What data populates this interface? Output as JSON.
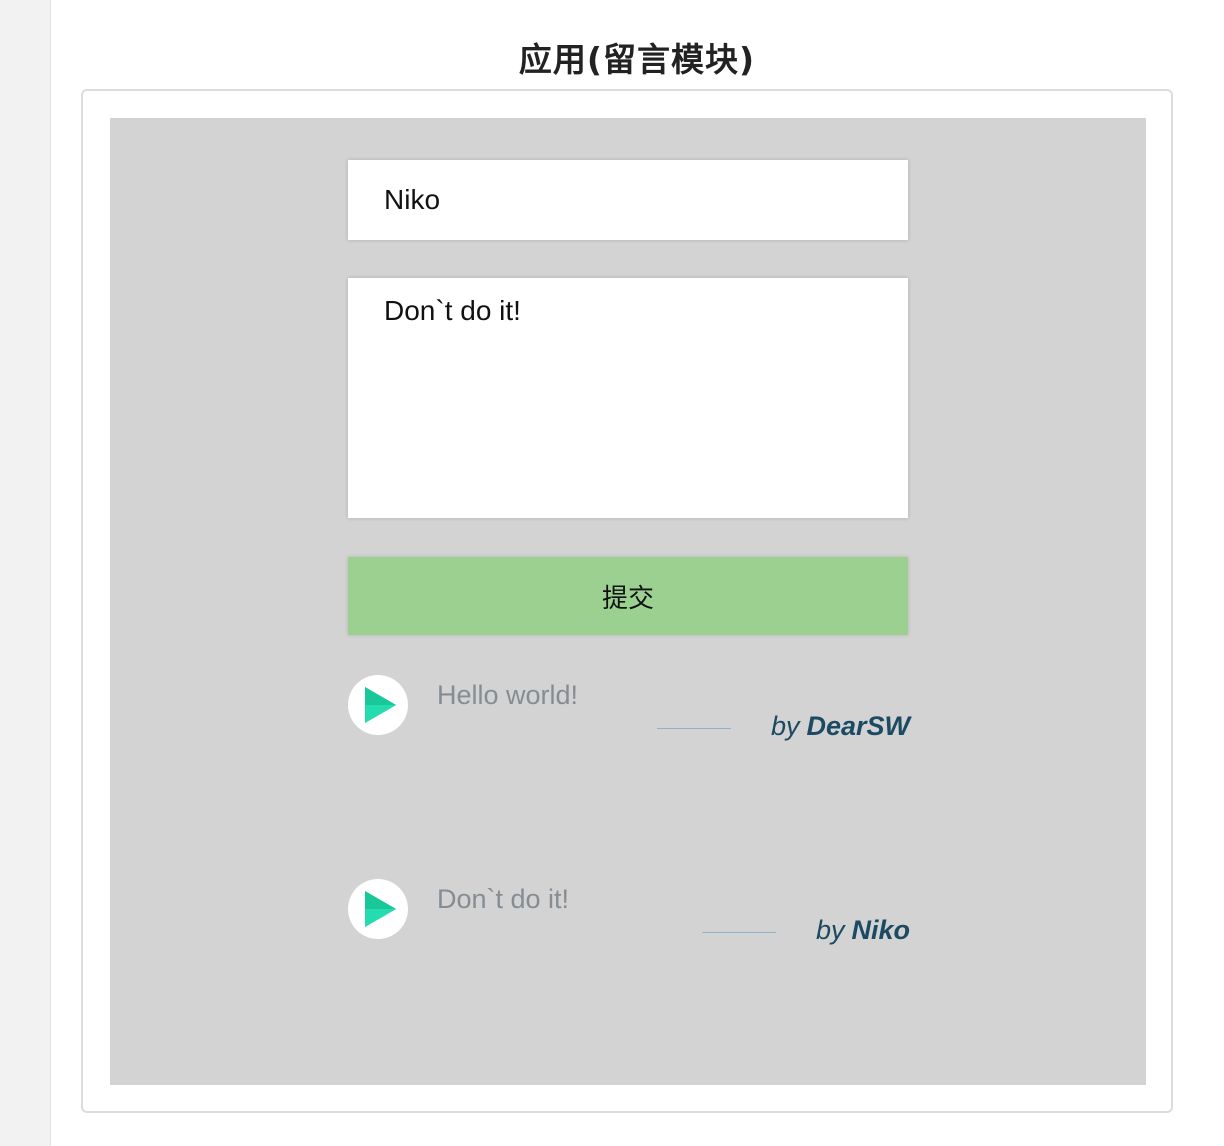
{
  "page": {
    "title": "应用(留言模块)"
  },
  "form": {
    "name_value": "Niko",
    "content_value": "Don`t do it!",
    "submit_label": "提交"
  },
  "comments": [
    {
      "text": "Hello world!",
      "by_label": "by",
      "author": "DearSW",
      "avatar_icon": "play-icon"
    },
    {
      "text": "Don`t do it!",
      "by_label": "by",
      "author": "Niko",
      "avatar_icon": "play-icon"
    }
  ],
  "colors": {
    "demo_background": "#d3d3d3",
    "submit_button": "#9bd091",
    "author_text": "#1b4a62",
    "comment_text": "#858d93",
    "play_icon": "#1fd3a6"
  }
}
